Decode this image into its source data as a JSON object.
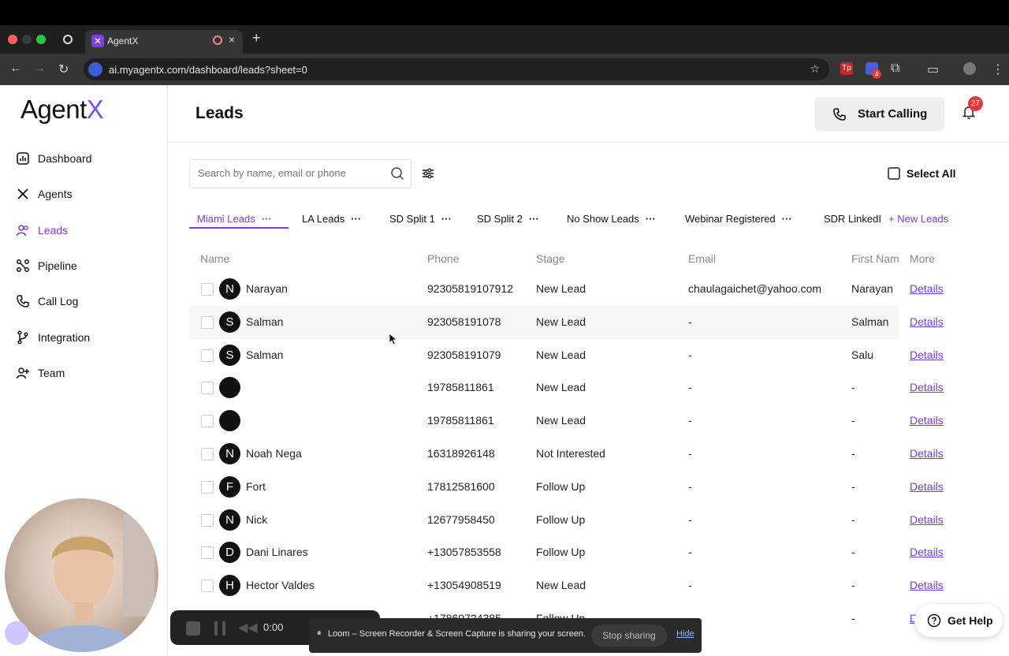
{
  "browser": {
    "tab_title": "AgentX",
    "url": "ai.myagentx.com/dashboard/leads?sheet=0",
    "extension_badge": "4"
  },
  "sidebar": {
    "logo_text": "Agent",
    "logo_accent": "X",
    "items": [
      {
        "label": "Dashboard",
        "icon": "dashboard-icon"
      },
      {
        "label": "Agents",
        "icon": "agents-icon"
      },
      {
        "label": "Leads",
        "icon": "leads-icon",
        "active": true
      },
      {
        "label": "Pipeline",
        "icon": "pipeline-icon"
      },
      {
        "label": "Call Log",
        "icon": "phone-icon"
      },
      {
        "label": "Integration",
        "icon": "integration-icon"
      },
      {
        "label": "Team",
        "icon": "team-icon"
      }
    ]
  },
  "header": {
    "title": "Leads",
    "start_calling": "Start Calling",
    "notification_count": "27"
  },
  "toolbar": {
    "search_placeholder": "Search by name, email or phone",
    "select_all": "Select All"
  },
  "sheets": {
    "tabs": [
      "Miami Leads",
      "LA Leads",
      "SD Split 1",
      "SD Split 2",
      "No Show Leads",
      "Webinar Registered",
      "SDR LinkedI"
    ],
    "new_leads": "New Leads"
  },
  "table": {
    "columns": [
      "Name",
      "Phone",
      "Stage",
      "Email",
      "First Nam",
      "More"
    ],
    "rows": [
      {
        "initial": "N",
        "name": "Narayan",
        "phone": "92305819107912",
        "stage": "New Lead",
        "email": "chaulagaichet@yahoo.com",
        "first_name": "Narayan",
        "more": "Details"
      },
      {
        "initial": "S",
        "name": "Salman",
        "phone": "923058191078",
        "stage": "New Lead",
        "email": "-",
        "first_name": "Salman",
        "more": "Details"
      },
      {
        "initial": "S",
        "name": "Salman",
        "phone": "923058191079",
        "stage": "New Lead",
        "email": "-",
        "first_name": "Salu",
        "more": "Details"
      },
      {
        "initial": "",
        "name": "",
        "phone": "19785811861",
        "stage": "New Lead",
        "email": "-",
        "first_name": "-",
        "more": "Details"
      },
      {
        "initial": "",
        "name": "",
        "phone": "19785811861",
        "stage": "New Lead",
        "email": "-",
        "first_name": "-",
        "more": "Details"
      },
      {
        "initial": "N",
        "name": "Noah Nega",
        "phone": "16318926148",
        "stage": "Not Interested",
        "email": "-",
        "first_name": "-",
        "more": "Details"
      },
      {
        "initial": "F",
        "name": "Fort",
        "phone": "17812581600",
        "stage": "Follow Up",
        "email": "-",
        "first_name": "-",
        "more": "Details"
      },
      {
        "initial": "N",
        "name": "Nick",
        "phone": "12677958450",
        "stage": "Follow Up",
        "email": "-",
        "first_name": "-",
        "more": "Details"
      },
      {
        "initial": "D",
        "name": "Dani Linares",
        "phone": "+13057853558",
        "stage": "Follow Up",
        "email": "-",
        "first_name": "-",
        "more": "Details"
      },
      {
        "initial": "H",
        "name": "Hector Valdes",
        "phone": "+13054908519",
        "stage": "New Lead",
        "email": "-",
        "first_name": "-",
        "more": "Details"
      },
      {
        "initial": "",
        "name": "",
        "phone": "+17869724385",
        "stage": "Follow Up",
        "email": "",
        "first_name": "-",
        "more": "De"
      }
    ]
  },
  "overlays": {
    "loom_time": "0:00",
    "share_text": "Loom – Screen Recorder & Screen Capture is sharing your screen.",
    "stop_sharing": "Stop sharing",
    "hide": "Hide",
    "get_help": "Get Help"
  },
  "colors": {
    "accent": "#7c3aed",
    "link": "#6d3cf0",
    "badge": "#e53935"
  }
}
